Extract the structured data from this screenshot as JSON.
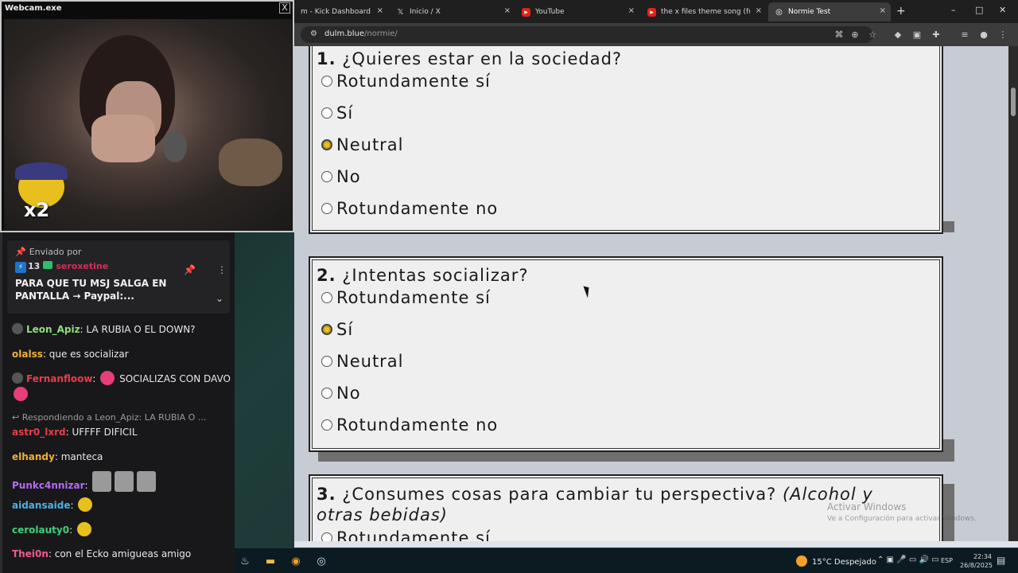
{
  "webcam": {
    "title": "Webcam.exe",
    "close": "X",
    "overlay_text": "x2"
  },
  "browser": {
    "tabs": [
      {
        "label": "m - Kick Dashboard",
        "icon": "kick-icon",
        "close": "×"
      },
      {
        "label": "Inicio / X",
        "icon": "x-logo-icon",
        "close": "×"
      },
      {
        "label": "YouTube",
        "icon": "youtube-icon",
        "close": "×"
      },
      {
        "label": "the x files theme song (full vers",
        "icon": "youtube-icon",
        "close": "×"
      },
      {
        "label": "Normie Test",
        "icon": "globe-icon",
        "close": "×",
        "active": true
      }
    ],
    "new_tab": "+",
    "window_controls": {
      "minimize": "–",
      "maximize": "□",
      "close": "✕"
    },
    "url_host": "dulm.blue",
    "url_path": "/normie/"
  },
  "quiz": {
    "q1": {
      "number": "1.",
      "text": "¿Quieres estar en la sociedad?",
      "options": [
        "Rotundamente sí",
        "Sí",
        "Neutral",
        "No",
        "Rotundamente no"
      ],
      "selected": 2
    },
    "q2": {
      "number": "2.",
      "text": "¿Intentas socializar?",
      "options": [
        "Rotundamente sí",
        "Sí",
        "Neutral",
        "No",
        "Rotundamente no"
      ],
      "selected": 1
    },
    "q3": {
      "number": "3.",
      "text": "¿Consumes cosas para cambiar tu perspectiva?",
      "emphasis": "(Alcohol y otras bebidas)",
      "first_option": "Rotundamente sí"
    }
  },
  "watermark": {
    "line1": "Activar Windows",
    "line2": "Ve a Configuración para activar Windows."
  },
  "chat": {
    "pinned": {
      "label": "Enviado por",
      "sub_count": "13",
      "user": "seroxetine",
      "text": "PARA QUE TU MSJ SALGA EN PANTALLA → Paypal:..."
    },
    "messages": [
      {
        "user": "Leon_Apiz",
        "color": "#8ee07a",
        "text": "LA RUBIA O EL DOWN?",
        "glyph": true
      },
      {
        "user": "olalss",
        "color": "#f2b134",
        "text": "que es socializar"
      },
      {
        "user": "Fernanfloow",
        "color": "#e63e4a",
        "text": "SOCIALIZAS CON DAVO",
        "glyph": true
      },
      {
        "reply": "Respondiendo a Leon_Apiz: LA RUBIA O ..."
      },
      {
        "user": "astr0_lxrd",
        "color": "#e63e4a",
        "text": "UFFFF DIFICIL"
      },
      {
        "user": "elhandy",
        "color": "#f2b134",
        "text": "manteca"
      },
      {
        "user": "Punkc4nnizar",
        "color": "#b36cf0",
        "text": ""
      },
      {
        "user": "aidansaide",
        "color": "#4fb0e8",
        "text": ""
      },
      {
        "user": "cerolauty0",
        "color": "#3fd07a",
        "text": ""
      },
      {
        "user": "Thei0n",
        "color": "#f25a8a",
        "text": "con el Ecko amigueas amigo"
      }
    ]
  },
  "taskbar": {
    "weather": "15°C  Despejado",
    "lang": "ESP",
    "time": "22:34",
    "date": "26/8/2025"
  },
  "colors": {
    "radio_selected": "#c8a21a",
    "card_bg": "#efefef",
    "page_bg": "#c7cbd4"
  }
}
